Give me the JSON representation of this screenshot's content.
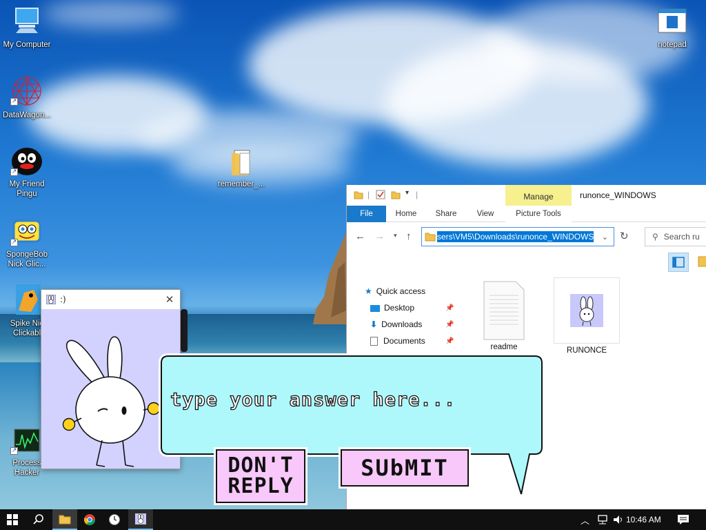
{
  "desktop": {
    "icons": [
      {
        "label": "My Computer"
      },
      {
        "label": "DataWagon..."
      },
      {
        "label": "My Friend Pingu"
      },
      {
        "label": "SpongeBob Nick Glic..."
      },
      {
        "label": "Spike Nic Clickabl"
      },
      {
        "label": "Process Hacker"
      },
      {
        "label": "remember_..."
      },
      {
        "label": "notepad"
      }
    ]
  },
  "popup": {
    "title": ":)",
    "close_glyph": "✕"
  },
  "explorer": {
    "manage_tab": "Manage",
    "window_title": "runonce_WINDOWS",
    "tabs": {
      "file": "File",
      "home": "Home",
      "share": "Share",
      "view": "View",
      "picture_tools": "Picture Tools"
    },
    "address": "sers\\VM5\\Downloads\\runonce_WINDOWS",
    "search_placeholder": "Search ru",
    "nav": {
      "quick_access": "Quick access",
      "desktop": "Desktop",
      "downloads": "Downloads",
      "documents": "Documents"
    },
    "files": [
      {
        "name": "readme"
      },
      {
        "name": "RUNONCE"
      }
    ]
  },
  "dialog": {
    "placeholder": "type your answer here...",
    "dont_reply_line1": "DON'T",
    "dont_reply_line2": "REPLY",
    "submit": "SUbMIT"
  },
  "taskbar": {
    "time": "10:46 AM"
  },
  "colors": {
    "bubble": "#aef8fb",
    "button": "#f7c8f9",
    "popup_bg": "#d3d2ff",
    "accent": "#0078d7",
    "manage_tab": "#f6f08f"
  }
}
